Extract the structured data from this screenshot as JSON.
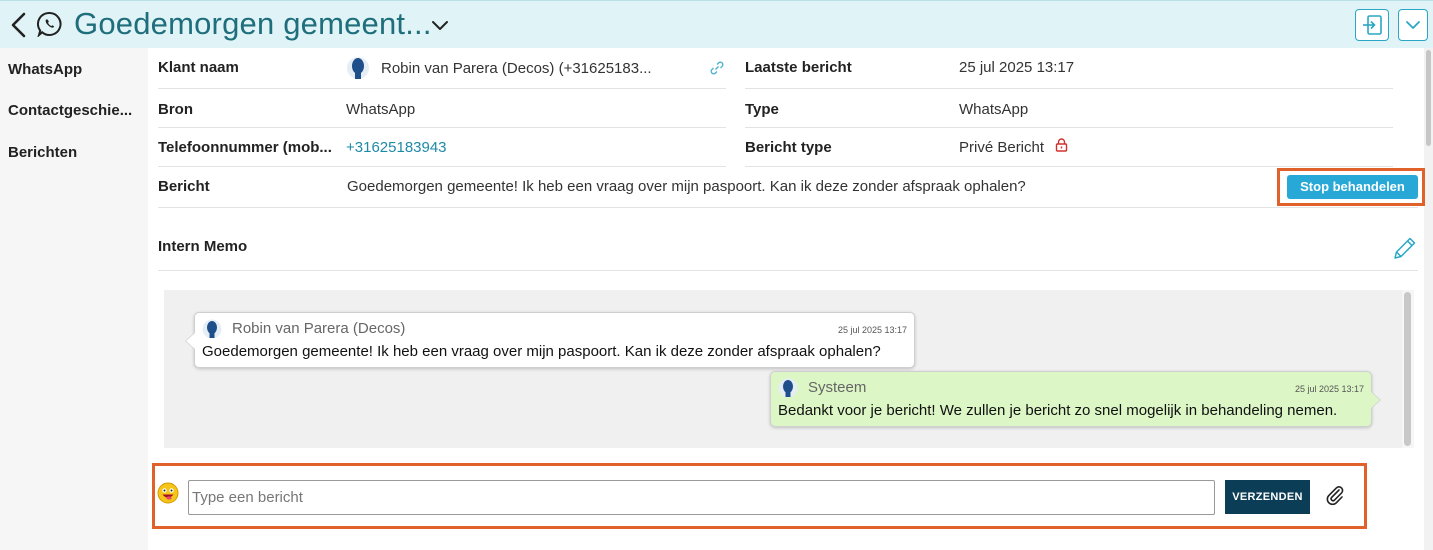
{
  "header": {
    "title": "Goedemorgen gemeent...",
    "icons": [
      "back-icon",
      "whatsapp-icon",
      "chevron-down-icon",
      "exit-icon",
      "chevron-down-icon"
    ]
  },
  "sidebar": {
    "items": [
      {
        "label": "WhatsApp"
      },
      {
        "label": "Contactgeschie..."
      },
      {
        "label": "Berichten"
      }
    ]
  },
  "details": {
    "klant_naam_label": "Klant naam",
    "klant_naam_value": "Robin van Parera (Decos) (+31625183...",
    "bron_label": "Bron",
    "bron_value": "WhatsApp",
    "telefoon_label": "Telefoonnummer (mob...",
    "telefoon_value": "+31625183943",
    "laatste_label": "Laatste bericht",
    "laatste_value": "25 jul 2025 13:17",
    "type_label": "Type",
    "type_value": "WhatsApp",
    "bericht_type_label": "Bericht type",
    "bericht_type_value": "Privé Bericht",
    "bericht_label": "Bericht",
    "bericht_value": "Goedemorgen gemeente! Ik heb een vraag over mijn paspoort. Kan ik deze zonder afspraak ophalen?",
    "stop_button": "Stop behandelen"
  },
  "memo": {
    "title": "Intern Memo"
  },
  "chat": {
    "messages": [
      {
        "sender": "Robin van Parera (Decos)",
        "time": "25 jul 2025 13:17",
        "text": "Goedemorgen gemeente! Ik heb een vraag over mijn paspoort. Kan ik deze zonder afspraak ophalen?"
      },
      {
        "sender": "Systeem",
        "time": "25 jul 2025 13:17",
        "text": "Bedankt voor je bericht! We zullen je bericht zo snel mogelijk in behandeling nemen."
      }
    ]
  },
  "composer": {
    "placeholder": "Type een bericht",
    "value": "",
    "send_label": "VERZENDEN"
  },
  "colors": {
    "accent": "#27a8d6",
    "header_bg": "#e0f3f7",
    "title": "#1e6e7c",
    "send_button": "#0c3d56",
    "highlight": "#e0622a",
    "outgoing_bubble": "#dcf6c6"
  }
}
